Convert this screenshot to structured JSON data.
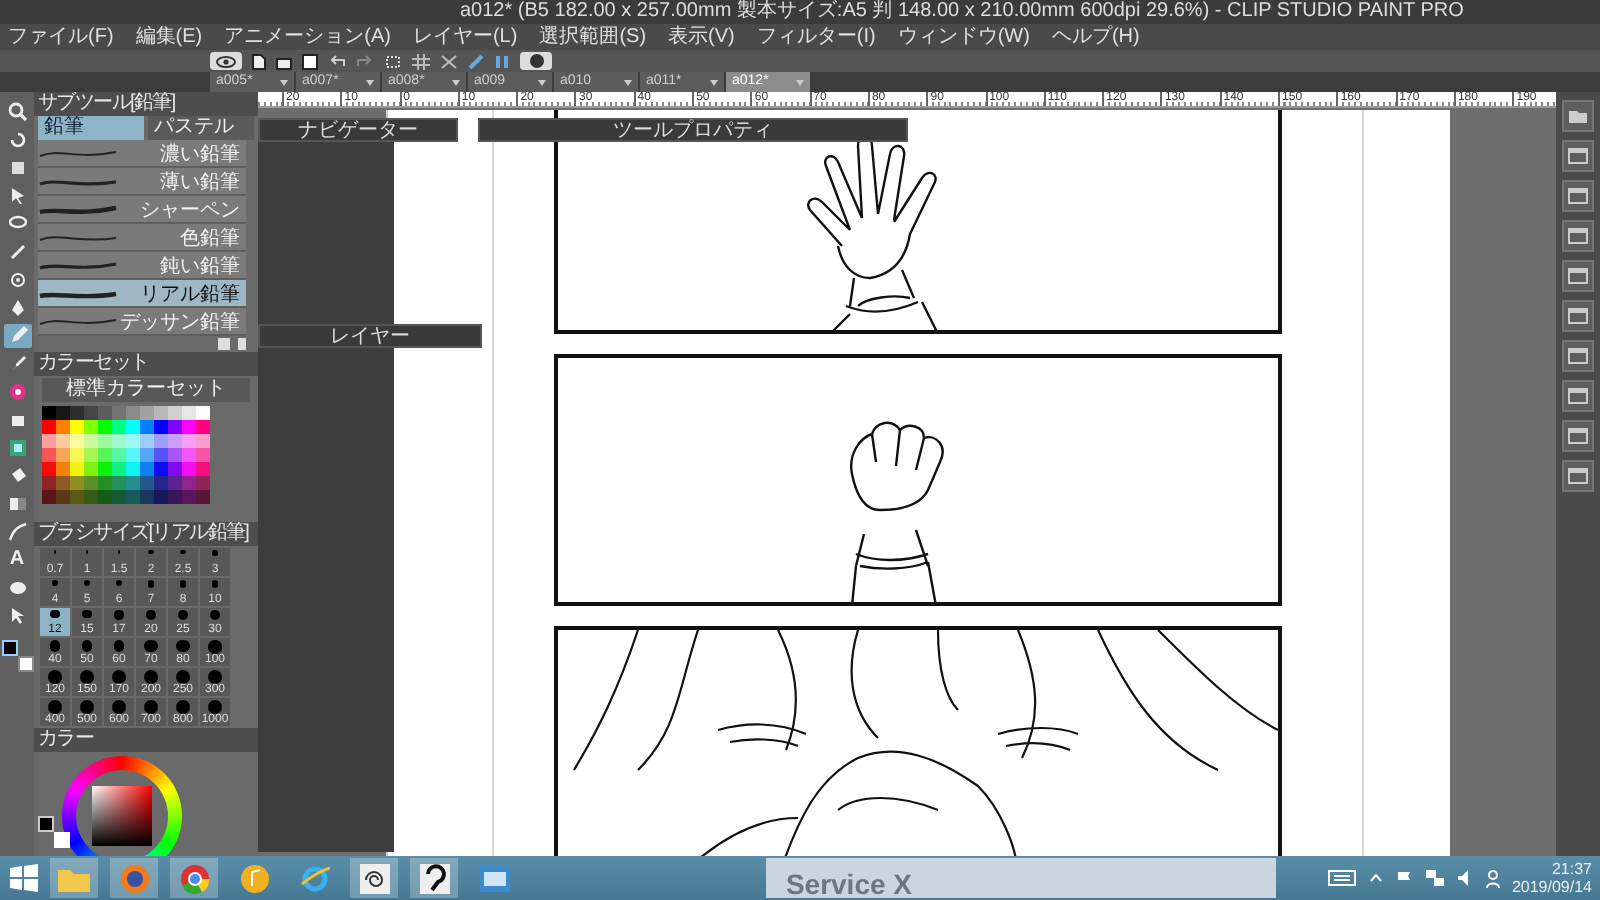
{
  "window": {
    "title": "a012* (B5 182.00 x 257.00mm 製本サイズ:A5 判 148.00 x 210.00mm 600dpi 29.6%) - CLIP STUDIO PAINT PRO"
  },
  "menu": [
    "ファイル(F)",
    "編集(E)",
    "アニメーション(A)",
    "レイヤー(L)",
    "選択範囲(S)",
    "表示(V)",
    "フィルター(I)",
    "ウィンドウ(W)",
    "ヘルプ(H)"
  ],
  "document_tabs": [
    {
      "label": "a005*",
      "selected": false
    },
    {
      "label": "a007*",
      "selected": false
    },
    {
      "label": "a008*",
      "selected": false
    },
    {
      "label": "a009",
      "selected": false
    },
    {
      "label": "a010",
      "selected": false
    },
    {
      "label": "a011*",
      "selected": false
    },
    {
      "label": "a012*",
      "selected": true
    }
  ],
  "tools": [
    {
      "selected": false
    },
    {
      "selected": false
    },
    {
      "selected": false
    },
    {
      "selected": false
    },
    {
      "selected": false
    },
    {
      "selected": false
    },
    {
      "selected": false
    },
    {
      "selected": false
    },
    {
      "selected": true
    },
    {
      "selected": false
    },
    {
      "selected": false
    },
    {
      "selected": false
    },
    {
      "selected": false
    },
    {
      "selected": false
    },
    {
      "selected": false
    },
    {
      "selected": false
    },
    {
      "selected": false,
      "glyph": "A"
    },
    {
      "selected": false
    },
    {
      "selected": false
    }
  ],
  "sub_tool": {
    "title": "サブツール[鉛筆]",
    "tabs": [
      {
        "label": "鉛筆",
        "selected": true
      },
      {
        "label": "パステル",
        "selected": false
      }
    ],
    "brushes": [
      {
        "name": "濃い鉛筆",
        "selected": false
      },
      {
        "name": "薄い鉛筆",
        "selected": false
      },
      {
        "name": "シャーペン",
        "selected": false
      },
      {
        "name": "色鉛筆",
        "selected": false
      },
      {
        "name": "鈍い鉛筆",
        "selected": false
      },
      {
        "name": "リアル鉛筆",
        "selected": true
      },
      {
        "name": "デッサン鉛筆",
        "selected": false
      }
    ]
  },
  "color_set": {
    "title": "カラーセット",
    "set_name": "標準カラーセット"
  },
  "brush_size": {
    "title": "ブラシサイズ[リアル鉛筆]",
    "sizes": [
      {
        "label": "0.7",
        "selected": false
      },
      {
        "label": "1",
        "selected": false
      },
      {
        "label": "1.5",
        "selected": false
      },
      {
        "label": "2",
        "selected": false
      },
      {
        "label": "2.5",
        "selected": false
      },
      {
        "label": "3",
        "selected": false
      },
      {
        "label": "4",
        "selected": false
      },
      {
        "label": "5",
        "selected": false
      },
      {
        "label": "6",
        "selected": false
      },
      {
        "label": "7",
        "selected": false
      },
      {
        "label": "8",
        "selected": false
      },
      {
        "label": "10",
        "selected": false
      },
      {
        "label": "12",
        "selected": true
      },
      {
        "label": "15",
        "selected": false
      },
      {
        "label": "17",
        "selected": false
      },
      {
        "label": "20",
        "selected": false
      },
      {
        "label": "25",
        "selected": false
      },
      {
        "label": "30",
        "selected": false
      },
      {
        "label": "40",
        "selected": false
      },
      {
        "label": "50",
        "selected": false
      },
      {
        "label": "60",
        "selected": false
      },
      {
        "label": "70",
        "selected": false
      },
      {
        "label": "80",
        "selected": false
      },
      {
        "label": "100",
        "selected": false
      },
      {
        "label": "120",
        "selected": false
      },
      {
        "label": "150",
        "selected": false
      },
      {
        "label": "170",
        "selected": false
      },
      {
        "label": "200",
        "selected": false
      },
      {
        "label": "250",
        "selected": false
      },
      {
        "label": "300",
        "selected": false
      },
      {
        "label": "400",
        "selected": false
      },
      {
        "label": "500",
        "selected": false
      },
      {
        "label": "600",
        "selected": false
      },
      {
        "label": "700",
        "selected": false
      },
      {
        "label": "800",
        "selected": false
      },
      {
        "label": "1000",
        "selected": false
      }
    ]
  },
  "color_wheel": {
    "title": "カラー"
  },
  "ruler": [
    "20",
    "10",
    "0",
    "10",
    "20",
    "30",
    "40",
    "50",
    "60",
    "70",
    "80",
    "90",
    "100",
    "110",
    "120",
    "130",
    "140",
    "150",
    "160",
    "170",
    "180",
    "190"
  ],
  "panels": {
    "navigator": "ナビゲーター",
    "layer": "レイヤー",
    "tool_property": "ツールプロパティ"
  },
  "taskbar": {
    "preview_title": "Service X",
    "time": "21:37",
    "date": "2019/09/14"
  }
}
